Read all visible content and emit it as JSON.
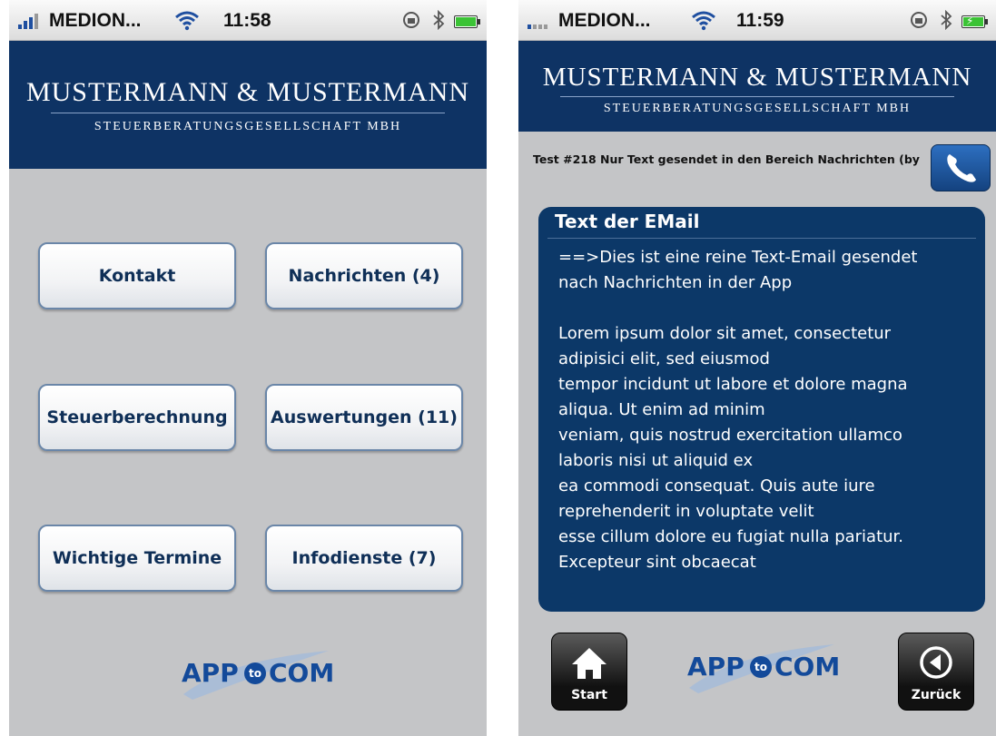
{
  "left_screen": {
    "status_bar": {
      "carrier": "MEDION...",
      "time": "11:58"
    },
    "header": {
      "company_name": "MUSTERMANN & MUSTERMANN",
      "company_subtitle": "STEUERBERATUNGSGESELLSCHAFT MBH"
    },
    "menu": [
      {
        "label": "Kontakt"
      },
      {
        "label": "Nachrichten (4)"
      },
      {
        "label": "Steuerberechnung"
      },
      {
        "label": "Auswertungen (11)"
      },
      {
        "label": "Wichtige Termine"
      },
      {
        "label": "Infodienste (7)"
      }
    ],
    "logo": {
      "left": "APP",
      "mid": "to",
      "right": "COM"
    }
  },
  "right_screen": {
    "status_bar": {
      "carrier": "MEDION...",
      "time": "11:59"
    },
    "header": {
      "company_name": "MUSTERMANN & MUSTERMANN",
      "company_subtitle": "STEUERBERATUNGSGESELLSCHAFT MBH"
    },
    "message_subject": "Test #218 Nur Text gesendet in den Bereich Nachrichten (by",
    "email": {
      "title": "Text der EMail",
      "body": "==>Dies ist eine reine Text-Email gesendet\nnach Nachrichten in der App\n\nLorem ipsum dolor sit amet, consectetur\nadipisici elit, sed eiusmod\ntempor incidunt ut labore et dolore magna\naliqua. Ut enim ad minim\nveniam, quis nostrud exercitation ullamco\nlaboris nisi ut aliquid ex\nea commodi consequat. Quis aute iure\nreprehenderit in voluptate velit\nesse cillum dolore eu fugiat nulla pariatur.\nExcepteur sint obcaecat"
    },
    "nav": {
      "start_label": "Start",
      "back_label": "Zurück"
    },
    "logo": {
      "left": "APP",
      "mid": "to",
      "right": "COM"
    }
  },
  "colors": {
    "header_blue": "#0e3364",
    "card_blue": "#0c3868",
    "background_gray": "#c4c5c7",
    "button_text": "#0f2f57"
  }
}
